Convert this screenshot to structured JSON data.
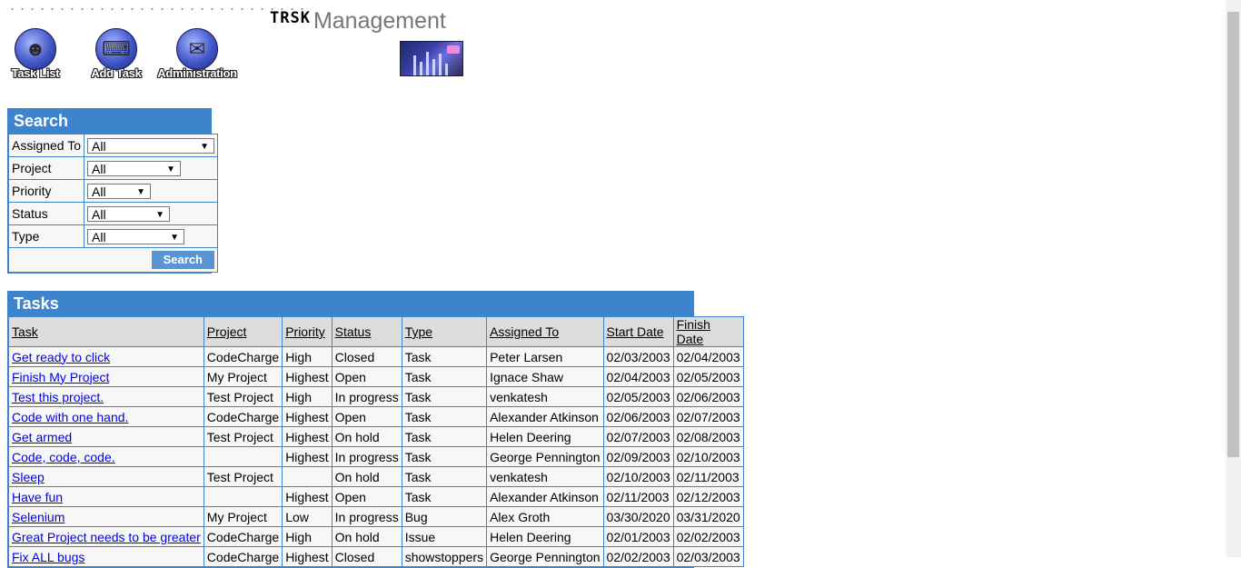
{
  "logo": {
    "part1": "TRSK",
    "part2": "Management"
  },
  "nav": [
    {
      "label": "Task List",
      "icon": "person-icon"
    },
    {
      "label": "Add Task",
      "icon": "computer-user-icon"
    },
    {
      "label": "Administration",
      "icon": "documents-icon"
    }
  ],
  "search": {
    "title": "Search",
    "fields": [
      {
        "label": "Assigned To",
        "value": "All"
      },
      {
        "label": "Project",
        "value": "All"
      },
      {
        "label": "Priority",
        "value": "All"
      },
      {
        "label": "Status",
        "value": "All"
      },
      {
        "label": "Type",
        "value": "All"
      }
    ],
    "button": "Search"
  },
  "tasks": {
    "title": "Tasks",
    "columns": [
      "Task",
      "Project",
      "Priority",
      "Status",
      "Type",
      "Assigned To",
      "Start Date",
      "Finish Date"
    ],
    "rows": [
      [
        "Get ready to click",
        "CodeCharge",
        "High",
        "Closed",
        "Task",
        "Peter Larsen",
        "02/03/2003",
        "02/04/2003"
      ],
      [
        "Finish My Project",
        "My Project",
        "Highest",
        "Open",
        "Task",
        "Ignace Shaw",
        "02/04/2003",
        "02/05/2003"
      ],
      [
        "Test this project.",
        "Test Project",
        "High",
        "In progress",
        "Task",
        "venkatesh",
        "02/05/2003",
        "02/06/2003"
      ],
      [
        "Code with one hand.",
        "CodeCharge",
        "Highest",
        "Open",
        "Task",
        "Alexander Atkinson",
        "02/06/2003",
        "02/07/2003"
      ],
      [
        "Get armed",
        "Test Project",
        "Highest",
        "On hold",
        "Task",
        "Helen Deering",
        "02/07/2003",
        "02/08/2003"
      ],
      [
        "Code, code, code.",
        "",
        "Highest",
        "In progress",
        "Task",
        "George Pennington",
        "02/09/2003",
        "02/10/2003"
      ],
      [
        "Sleep",
        "Test Project",
        "",
        "On hold",
        "Task",
        "venkatesh",
        "02/10/2003",
        "02/11/2003"
      ],
      [
        "Have fun",
        "",
        "Highest",
        "Open",
        "Task",
        "Alexander Atkinson",
        "02/11/2003",
        "02/12/2003"
      ],
      [
        "Selenium",
        "My Project",
        "Low",
        "In progress",
        "Bug",
        "Alex Groth",
        "03/30/2020",
        "03/31/2020"
      ],
      [
        "Great Project needs to be greater",
        "CodeCharge",
        "High",
        "On hold",
        "Issue",
        "Helen Deering",
        "02/01/2003",
        "02/02/2003"
      ],
      [
        "Fix ALL bugs",
        "CodeCharge",
        "Highest",
        "Closed",
        "showstoppers",
        "George Pennington",
        "02/02/2003",
        "02/03/2003"
      ]
    ]
  }
}
